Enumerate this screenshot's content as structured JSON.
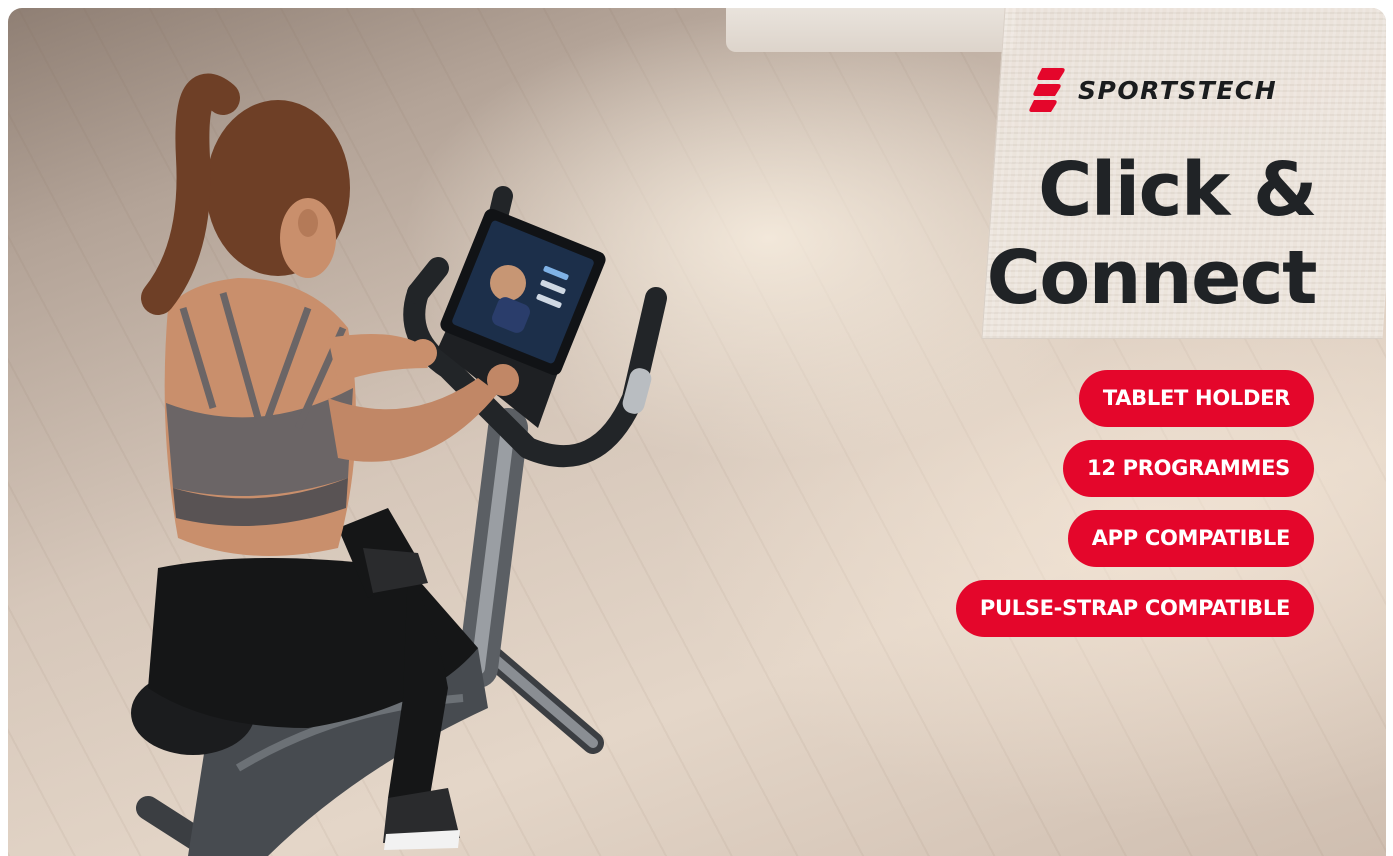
{
  "brand": {
    "name": "SPORTSTECH",
    "accent_color": "#e4062b",
    "logo_icon": "sportstech-stripe-icon"
  },
  "headline": {
    "line1": "Click &",
    "line2": "Connect"
  },
  "features": [
    {
      "label": "TABLET HOLDER"
    },
    {
      "label": "12 PROGRAMMES"
    },
    {
      "label": "APP COMPATIBLE"
    },
    {
      "label": "PULSE-STRAP COMPATIBLE"
    }
  ],
  "photo": {
    "subject_icon": "woman-on-exercise-bike-illustration"
  }
}
